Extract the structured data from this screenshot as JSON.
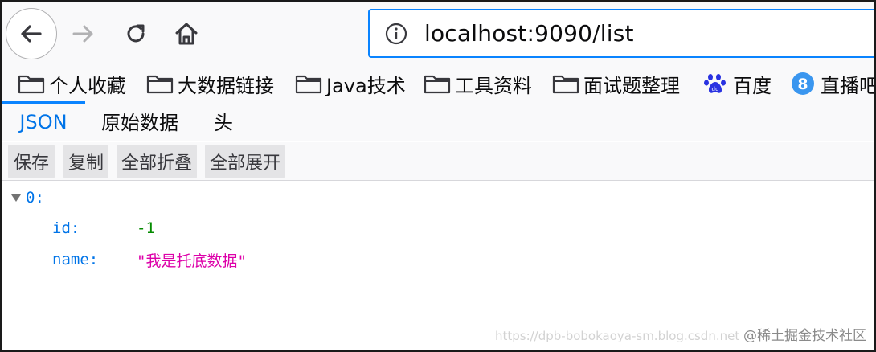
{
  "url": "localhost:9090/list",
  "bookmarks": [
    {
      "label": "个人收藏",
      "icon": "folder-icon"
    },
    {
      "label": "大数据链接",
      "icon": "folder-icon"
    },
    {
      "label": "Java技术",
      "icon": "folder-icon"
    },
    {
      "label": "工具资料",
      "icon": "folder-icon"
    },
    {
      "label": "面试题整理",
      "icon": "folder-icon"
    },
    {
      "label": "百度",
      "icon": "baidu-paw-icon"
    },
    {
      "label": "直播吧",
      "icon": "zhibo8-icon"
    }
  ],
  "tabs": {
    "json": "JSON",
    "raw": "原始数据",
    "headers": "头"
  },
  "buttons": {
    "save": "保存",
    "copy": "复制",
    "collapse_all": "全部折叠",
    "expand_all": "全部展开"
  },
  "tree": {
    "index_key": "0:",
    "rows": [
      {
        "key": "id:",
        "value": "-1"
      },
      {
        "key": "name:",
        "value": "\"我是托底数据\""
      }
    ]
  },
  "watermark": {
    "url": "https://dpb-bobokaoya-sm.blog.csdn.net",
    "text": "@稀土掘金技术社区"
  },
  "colors": {
    "accent": "#0a84ff",
    "key": "#0074e8",
    "number": "#058b00",
    "string": "#dd00a9"
  }
}
